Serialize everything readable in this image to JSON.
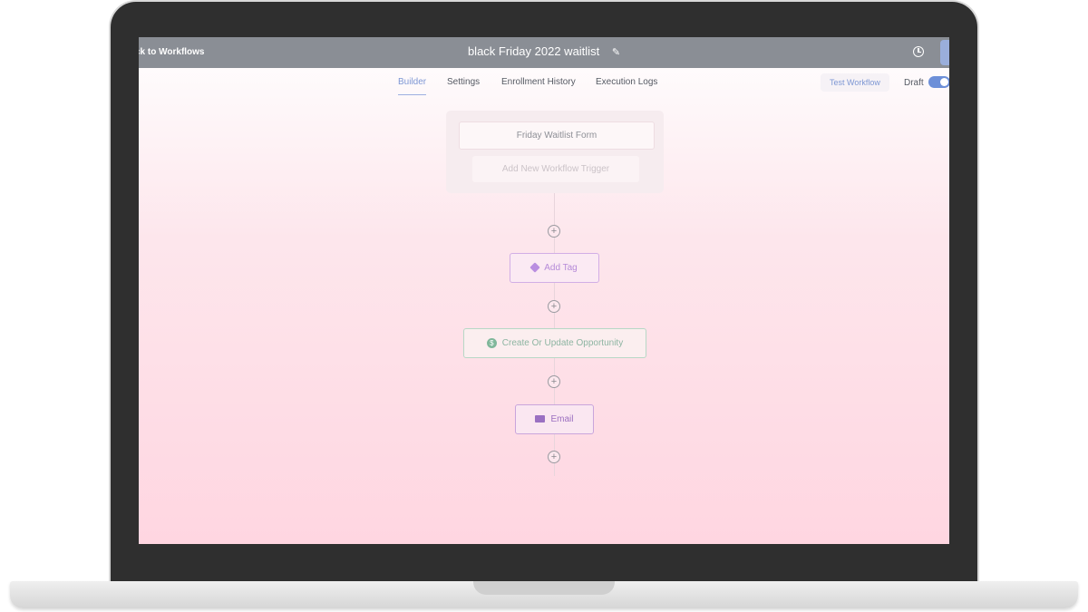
{
  "app": {
    "back_link": "ck to Workflows",
    "title": "black Friday 2022 waitlist",
    "edit_icon": "pencil-icon",
    "history_icon": "clock-icon"
  },
  "tabs": [
    {
      "label": "Builder",
      "active": true
    },
    {
      "label": "Settings",
      "active": false
    },
    {
      "label": "Enrollment History",
      "active": false
    },
    {
      "label": "Execution Logs",
      "active": false
    }
  ],
  "toolbar": {
    "test_workflow_label": "Test Workflow",
    "draft_label": "Draft",
    "draft_enabled": true
  },
  "workflow": {
    "triggers": {
      "items": [
        "Friday Waitlist Form"
      ],
      "add_label": "Add New Workflow Trigger"
    },
    "actions": [
      {
        "label": "Add Tag",
        "icon": "tag-icon"
      },
      {
        "label": "Create Or Update Opportunity",
        "icon": "dollar-icon"
      },
      {
        "label": "Email",
        "icon": "mail-icon"
      }
    ],
    "add_step_symbol": "+"
  },
  "colors": {
    "accent": "#7d97d4",
    "topbar": "#8a8e95",
    "tag": "#b58ad8",
    "opportunity": "#8db5a2",
    "email": "#9b6fc0"
  }
}
